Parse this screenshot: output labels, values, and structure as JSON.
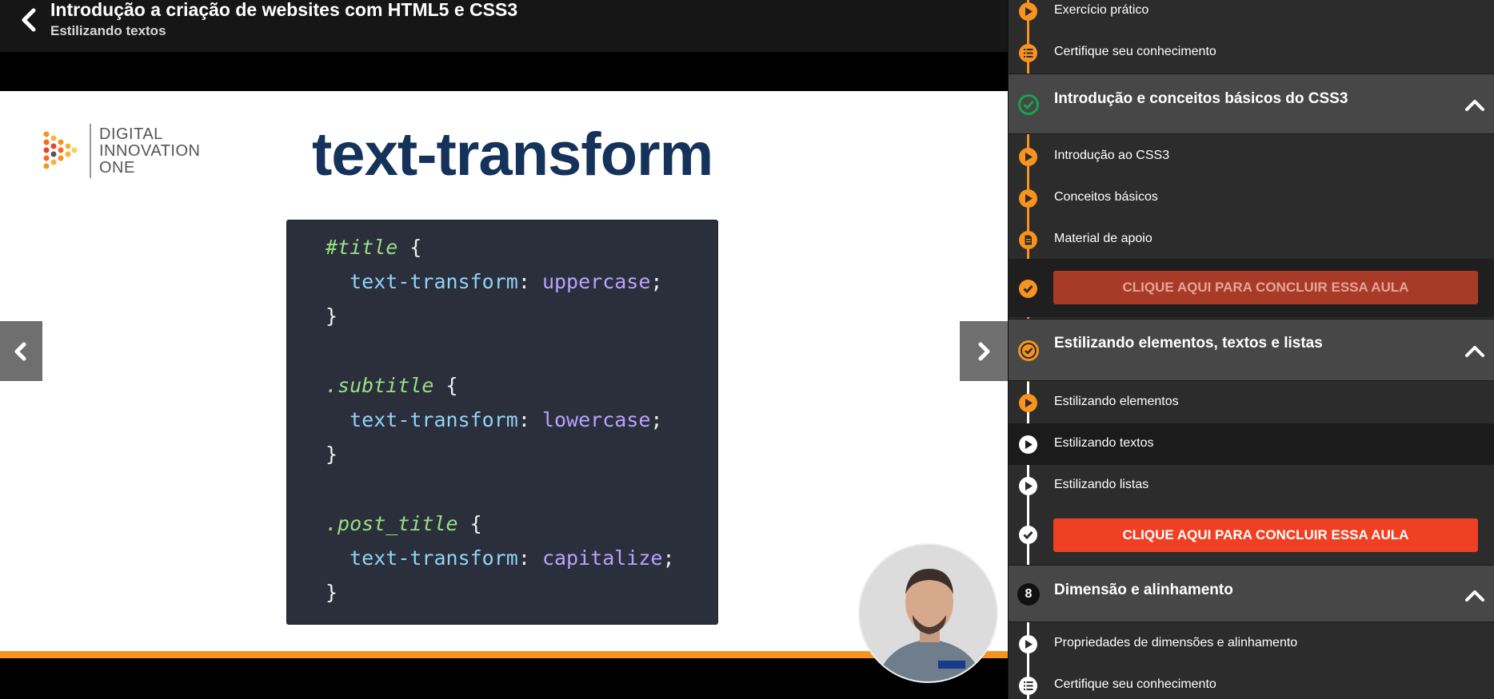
{
  "header": {
    "course_title": "Introdução a criação de websites com HTML5 e CSS3",
    "lesson_title": "Estilizando textos"
  },
  "slide": {
    "logo_lines": [
      "DIGITAL",
      "INNOVATION",
      "ONE"
    ],
    "title": "text-transform",
    "code": [
      {
        "selector": "#title",
        "rest": " {"
      },
      {
        "property": "text-transform",
        "value": "uppercase"
      },
      {
        "close": "}"
      },
      {
        "blank": true
      },
      {
        "selector": ".subtitle",
        "rest": " {"
      },
      {
        "property": "text-transform",
        "value": "lowercase"
      },
      {
        "close": "}"
      },
      {
        "blank": true
      },
      {
        "selector": ".post_title",
        "rest": " {"
      },
      {
        "property": "text-transform",
        "value": "capitalize"
      },
      {
        "close": "}"
      }
    ]
  },
  "sidebar": {
    "top_items": [
      {
        "label": "Exercício prático",
        "icon": "play-icon"
      },
      {
        "label": "Certifique seu conhecimento",
        "icon": "list-icon"
      }
    ],
    "sections": [
      {
        "title": "Introdução e conceitos básicos do CSS3",
        "status_icon": "check-circle-icon",
        "items": [
          {
            "label": "Introdução ao CSS3",
            "icon": "play-icon"
          },
          {
            "label": "Conceitos básicos",
            "icon": "play-icon"
          },
          {
            "label": "Material de apoio",
            "icon": "document-icon"
          }
        ],
        "complete_label": "CLIQUE AQUI PARA CONCLUIR ESSA AULA"
      },
      {
        "title": "Estilizando elementos, textos e listas",
        "status_icon": "progress-check-icon",
        "items": [
          {
            "label": "Estilizando elementos",
            "icon": "play-icon"
          },
          {
            "label": "Estilizando textos",
            "icon": "play-icon"
          },
          {
            "label": "Estilizando listas",
            "icon": "play-icon"
          }
        ],
        "complete_label": "CLIQUE AQUI PARA CONCLUIR ESSA AULA"
      },
      {
        "title": "Dimensão e alinhamento",
        "number": "8",
        "items": [
          {
            "label": "Propriedades de dimensões e alinhamento",
            "icon": "play-icon"
          },
          {
            "label": "Certifique seu conhecimento",
            "icon": "list-icon"
          }
        ]
      }
    ]
  },
  "colors": {
    "accent": "#f7931e",
    "done_button_muted": "#a83a28",
    "done_button_active": "#ef4023",
    "check_green": "#1aa34a",
    "slide_title": "#15335a"
  }
}
